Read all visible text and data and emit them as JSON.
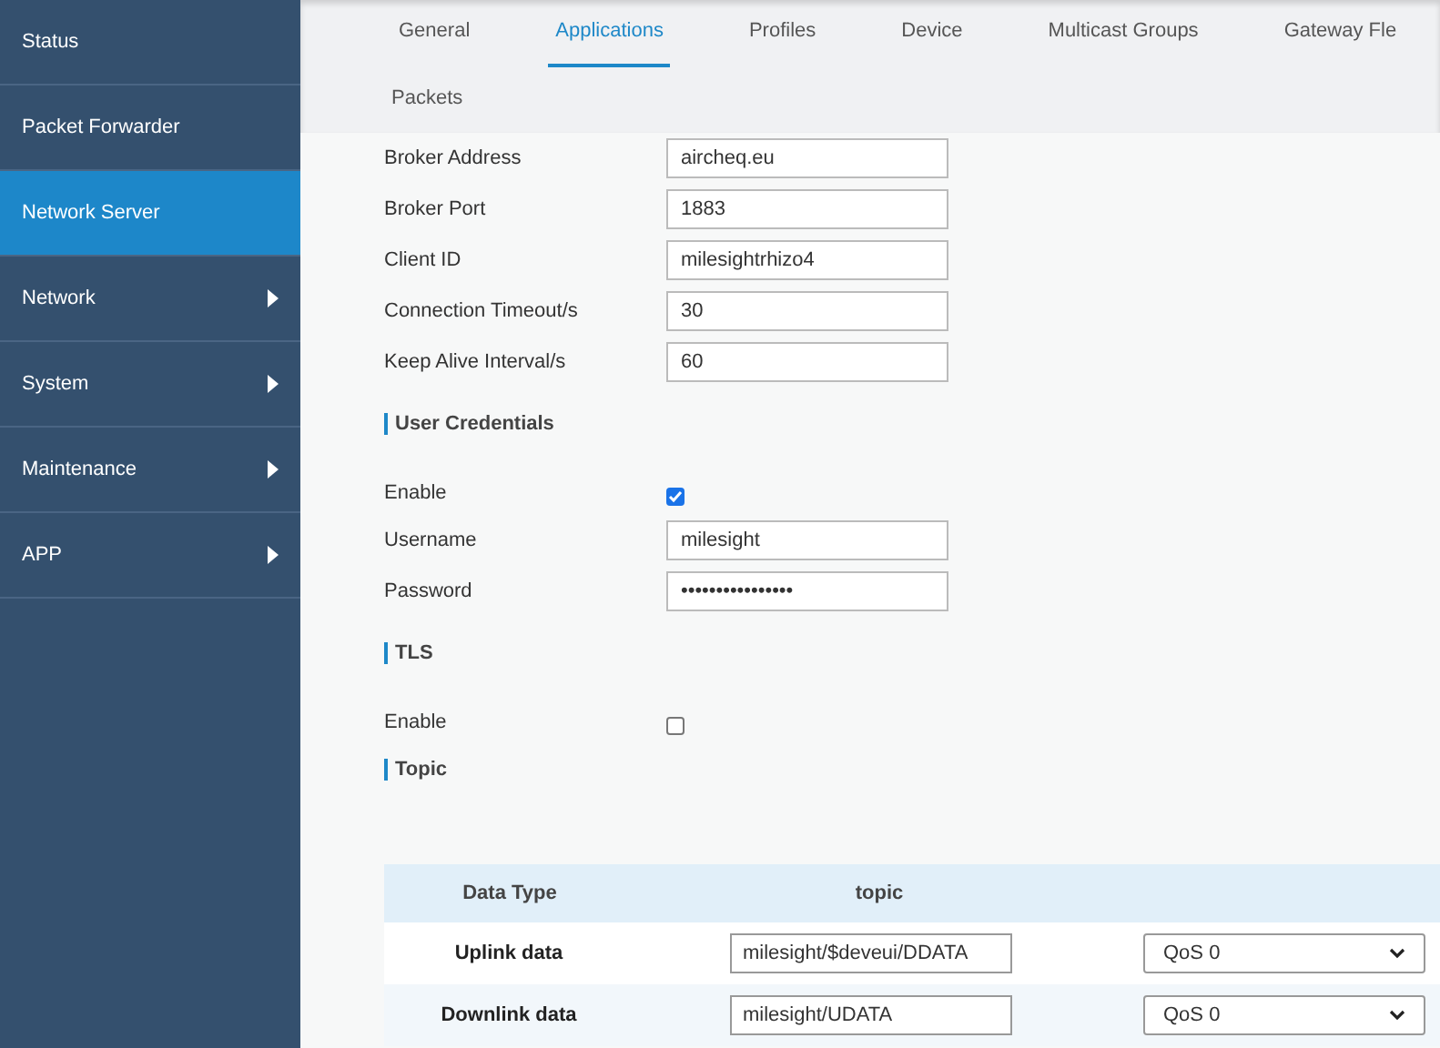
{
  "sidebar": {
    "items": [
      {
        "label": "Status",
        "selected": false,
        "expandable": false
      },
      {
        "label": "Packet Forwarder",
        "selected": false,
        "expandable": false
      },
      {
        "label": "Network Server",
        "selected": true,
        "expandable": false
      },
      {
        "label": "Network",
        "selected": false,
        "expandable": true
      },
      {
        "label": "System",
        "selected": false,
        "expandable": true
      },
      {
        "label": "Maintenance",
        "selected": false,
        "expandable": true
      },
      {
        "label": "APP",
        "selected": false,
        "expandable": true
      }
    ]
  },
  "tabs": [
    {
      "label": "General",
      "selected": false
    },
    {
      "label": "Applications",
      "selected": true
    },
    {
      "label": "Profiles",
      "selected": false
    },
    {
      "label": "Device",
      "selected": false
    },
    {
      "label": "Multicast Groups",
      "selected": false
    },
    {
      "label": "Gateway Fle",
      "selected": false
    },
    {
      "label": "Packets",
      "selected": false
    }
  ],
  "broker_fields": [
    {
      "label": "Broker Address",
      "value": "aircheq.eu"
    },
    {
      "label": "Broker Port",
      "value": "1883"
    },
    {
      "label": "Client ID",
      "value": "milesightrhizo4"
    },
    {
      "label": "Connection Timeout/s",
      "value": "30"
    },
    {
      "label": "Keep Alive Interval/s",
      "value": "60"
    }
  ],
  "user_credentials": {
    "title": "User Credentials",
    "enable_label": "Enable",
    "enabled": true,
    "fields": [
      {
        "label": "Username",
        "value": "milesight"
      },
      {
        "label": "Password",
        "value": "••••••••••••••••"
      }
    ]
  },
  "tls": {
    "title": "TLS",
    "enable_label": "Enable",
    "enabled": false
  },
  "topic": {
    "title": "Topic",
    "table": {
      "columns": [
        "Data Type",
        "topic"
      ],
      "rows": [
        {
          "data_type": "Uplink data",
          "topic": "milesight/$deveui/DDATA",
          "qos": "QoS 0"
        },
        {
          "data_type": "Downlink data",
          "topic": "milesight/UDATA",
          "qos": "QoS 0"
        }
      ]
    }
  }
}
